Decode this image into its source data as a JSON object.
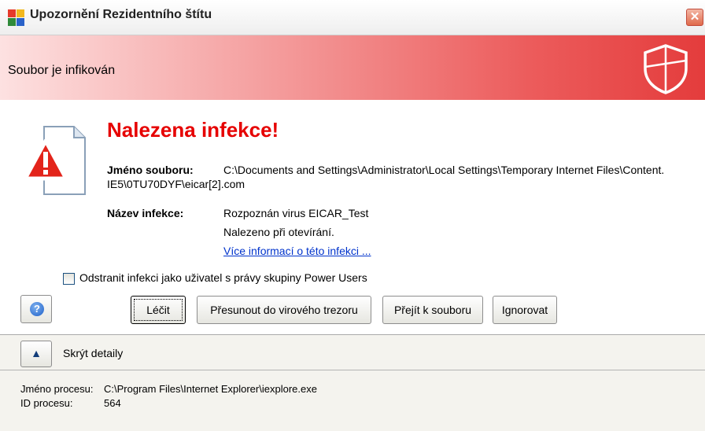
{
  "window": {
    "title": "Upozornění Rezidentního štítu",
    "close_glyph": "✕"
  },
  "banner": {
    "text": "Soubor je infikován",
    "icon": "shield-icon"
  },
  "alert": {
    "headline": "Nalezena infekce!",
    "file_label": "Jméno souboru:",
    "file_value_line1": "C:\\Documents and Settings\\Administrator\\Local Settings\\Temporary Internet Files\\Content.",
    "file_value_line2": "IE5\\0TU70DYF\\eicar[2].com",
    "infection_label": "Název infekce:",
    "infection_value": "Rozpoznán virus EICAR_Test",
    "found_on": "Nalezeno při otevírání.",
    "more_info_link": "Více informací o této infekci ..."
  },
  "option": {
    "checkbox_label": "Odstranit infekci jako uživatel s právy skupiny Power Users",
    "checked": false
  },
  "buttons": {
    "help_glyph": "?",
    "heal": "Léčit",
    "move_to_vault": "Přesunout do virového trezoru",
    "go_to_file": "Přejít k souboru",
    "ignore": "Ignorovat"
  },
  "details": {
    "toggle_glyph": "▲",
    "toggle_label": "Skrýt detaily",
    "process_name_label": "Jméno procesu:",
    "process_name_value": "C:\\Program Files\\Internet Explorer\\iexplore.exe",
    "process_id_label": "ID procesu:",
    "process_id_value": "564"
  },
  "colors": {
    "headline": "#e60000",
    "banner_end": "#e43c3c",
    "link": "#0033cc"
  }
}
